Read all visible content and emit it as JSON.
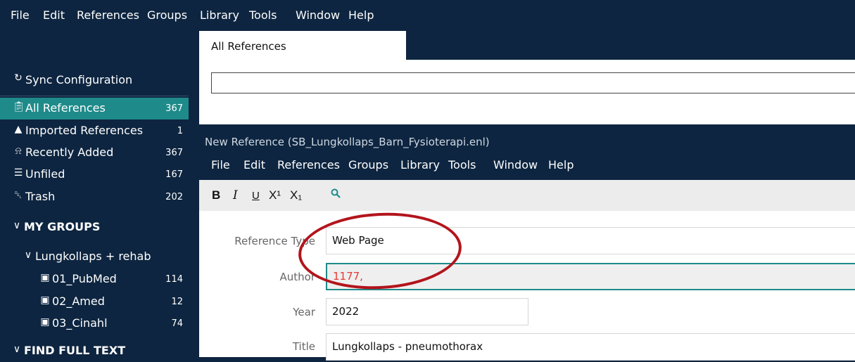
{
  "menubar": {
    "items": [
      "File",
      "Edit",
      "References",
      "Groups",
      "Library",
      "Tools",
      "Window",
      "Help"
    ]
  },
  "sidebar": {
    "sync_label": "Sync Configuration",
    "items": [
      {
        "label": "All References",
        "count": "367",
        "icon": "clipboard-icon"
      },
      {
        "label": "Imported References",
        "count": "1",
        "icon": "import-icon"
      },
      {
        "label": "Recently Added",
        "count": "367",
        "icon": "bell-icon"
      },
      {
        "label": "Unfiled",
        "count": "167",
        "icon": "list-icon"
      },
      {
        "label": "Trash",
        "count": "202",
        "icon": "trash-icon"
      }
    ],
    "my_groups_label": "MY GROUPS",
    "group_set": "Lungkollaps + rehab",
    "groups": [
      {
        "label": "01_PubMed",
        "count": "114"
      },
      {
        "label": "02_Amed",
        "count": "12"
      },
      {
        "label": "03_Cinahl",
        "count": "74"
      }
    ],
    "find_full_text_label": "FIND FULL TEXT"
  },
  "tab": {
    "label": "All References"
  },
  "new_reference": {
    "title": "New Reference (SB_Lungkollaps_Barn_Fysioterapi.enl)",
    "menu": [
      "File",
      "Edit",
      "References",
      "Groups",
      "Library",
      "Tools",
      "Window",
      "Help"
    ],
    "format": {
      "bold": "B",
      "italic": "I",
      "underline": "U",
      "superscript": "X¹",
      "subscript": "X₁"
    },
    "fields": {
      "reference_type_label": "Reference Type",
      "reference_type_value": "Web Page",
      "author_label": "Author",
      "author_value": "1177,",
      "year_label": "Year",
      "year_value": "2022",
      "title_label": "Title",
      "title_value": "Lungkollaps - pneumothorax"
    }
  },
  "colors": {
    "navy": "#0d2540",
    "selected": "#1f8a8a",
    "annotation": "#b3141c",
    "author_text": "#e53935"
  }
}
